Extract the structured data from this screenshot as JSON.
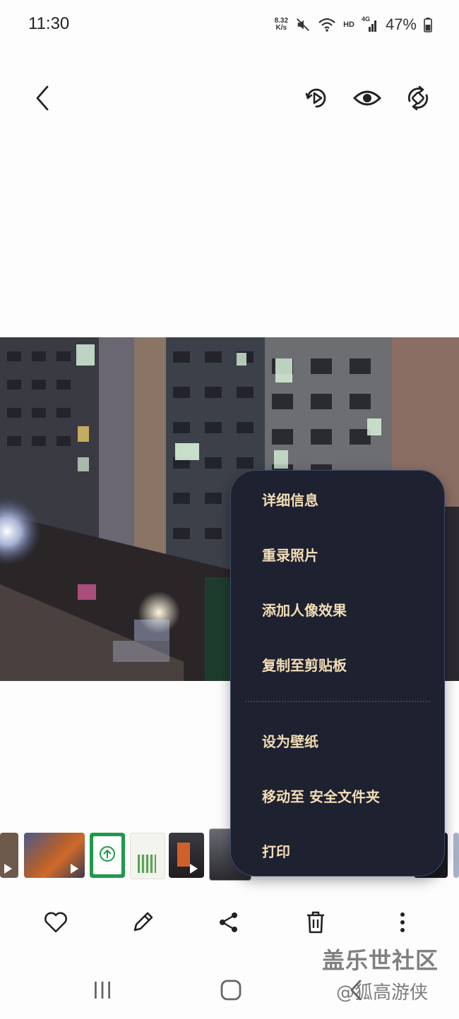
{
  "status_bar": {
    "time": "11:30",
    "net_speed_value": "8.32",
    "net_speed_unit": "K/s",
    "hd_label": "HD",
    "signal_label": "4G",
    "battery": "47%"
  },
  "top_bar": {
    "icons": [
      "back-icon",
      "motion-play-icon",
      "eye-icon",
      "rotate-icon"
    ]
  },
  "menu": {
    "items": [
      {
        "label": "详细信息"
      },
      {
        "label": "重录照片"
      },
      {
        "label": "添加人像效果"
      },
      {
        "label": "复制至剪贴板"
      },
      {
        "label": "设为壁纸"
      },
      {
        "label": "移动至 安全文件夹"
      },
      {
        "label": "打印"
      }
    ]
  },
  "bottom_bar": {
    "icons": [
      "heart-icon",
      "edit-icon",
      "share-icon",
      "delete-icon",
      "more-icon"
    ]
  },
  "watermark": {
    "line1": "盖乐世社区",
    "line2": "@狐高游侠"
  },
  "colors": {
    "menu_bg": "#1d2130",
    "menu_text": "#f3ddb5",
    "menu_border": "#3d4a6e"
  }
}
